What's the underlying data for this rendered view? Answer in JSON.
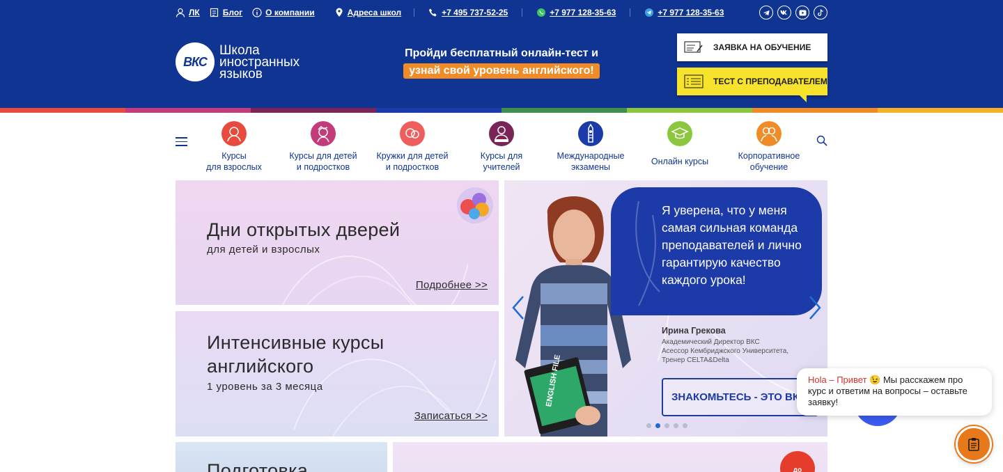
{
  "topbar": {
    "lk": "ЛК",
    "blog": "Блог",
    "about": "О компании",
    "addresses": "Адреса школ",
    "phone1": "+7 495 737-52-25",
    "phone2": "+7 977 128-35-63",
    "phone3": "+7 977 128-35-63",
    "socials": [
      "telegram-icon",
      "vk-icon",
      "youtube-icon",
      "tiktok-icon"
    ]
  },
  "logo": {
    "mark": "ВКС",
    "line1": "Школа",
    "line2": "иностранных",
    "line3": "языков"
  },
  "promo": {
    "line1": "Пройди бесплатный онлайн-тест и",
    "line2": "узнай свой уровень английского!"
  },
  "buttons": {
    "apply": "ЗАЯВКА НА ОБУЧЕНИЕ",
    "test": "ТЕСТ С ПРЕПОДАВАТЕЛЕМ"
  },
  "nav": [
    {
      "line1": "Курсы",
      "line2": "для взрослых",
      "color": "#e84a3c"
    },
    {
      "line1": "Курсы для детей",
      "line2": "и подростков",
      "color": "#c23b7b"
    },
    {
      "line1": "Кружки для детей",
      "line2": "и подростков",
      "color": "#ef5d5d"
    },
    {
      "line1": "Курсы для",
      "line2": "учителей",
      "color": "#7a2458"
    },
    {
      "line1": "Международные",
      "line2": "экзамены",
      "color": "#1c3aa8"
    },
    {
      "line1": "Онлайн курсы",
      "line2": "",
      "color": "#8cc63f"
    },
    {
      "line1": "Корпоративное",
      "line2": "обучение",
      "color": "#f08c28"
    }
  ],
  "banners": {
    "open_days": {
      "title": "Дни открытых дверей",
      "subtitle": "для детей и взрослых",
      "link": "Подробнее >>"
    },
    "intensive": {
      "title_line1": "Интенсивные курсы",
      "title_line2": "английского",
      "subtitle": "1 уровень за 3 месяца",
      "link": "Записаться >>"
    },
    "bottom_left_title": "Подготовка",
    "fire_badge": "до"
  },
  "slider": {
    "quote": "Я уверена, что у меня самая сильная команда преподавателей и лично гарантирую качество каждого урока!",
    "name": "Ирина Грекова",
    "role_line1": "Академический Директор ВКС",
    "role_line2": "Асессор Кембриджского Университета,",
    "role_line3": "Тренер CELTA&Delta",
    "book_text": "ENGLISH FILE",
    "button": "ЗНАКОМЬТЕСЬ - ЭТО ВКС",
    "slides_count": 5,
    "active_slide": 2
  },
  "chat": {
    "hola": "Hola – Привет",
    "emoji": "😉",
    "text": " Мы расскажем про курс и ответим на вопросы – оставьте заявку!"
  },
  "colors": {
    "header_bg": "#0f3492",
    "accent_orange": "#f08c28",
    "test_yellow": "#f7e32b",
    "stripe": [
      "#e84a3c",
      "#c23b7b",
      "#7a2458",
      "#1c3aa8",
      "#3f8f4f",
      "#8cc63f",
      "#f08c28",
      "#f5b324"
    ]
  }
}
